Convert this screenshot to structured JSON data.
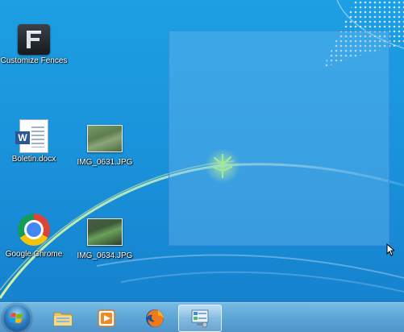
{
  "desktop": {
    "icons": [
      {
        "id": "customize-fences",
        "label": "Customize Fences",
        "icon": "fences-icon"
      },
      {
        "id": "boletin-docx",
        "label": "Boletin.docx",
        "icon": "word-document-icon"
      },
      {
        "id": "img-0631",
        "label": "IMG_0631.JPG",
        "icon": "photo-thumbnail-icon"
      },
      {
        "id": "google-chrome",
        "label": "Google Chrome",
        "icon": "chrome-icon"
      },
      {
        "id": "img-0634",
        "label": "IMG_0634.JPG",
        "icon": "photo-thumbnail-icon"
      }
    ]
  },
  "taskbar": {
    "start": {
      "icon": "windows-start-icon"
    },
    "pinned": [
      {
        "name": "windows-explorer",
        "icon": "folder-icon",
        "active": false
      },
      {
        "name": "media-player",
        "icon": "media-player-icon",
        "active": false
      },
      {
        "name": "firefox",
        "icon": "firefox-icon",
        "active": false
      },
      {
        "name": "control-panel",
        "icon": "control-panel-icon",
        "active": true
      }
    ]
  },
  "colors": {
    "desktop_bg": "#1a93db",
    "selection_fill": "#78bef0",
    "selection_border": "#3c8cdc"
  }
}
